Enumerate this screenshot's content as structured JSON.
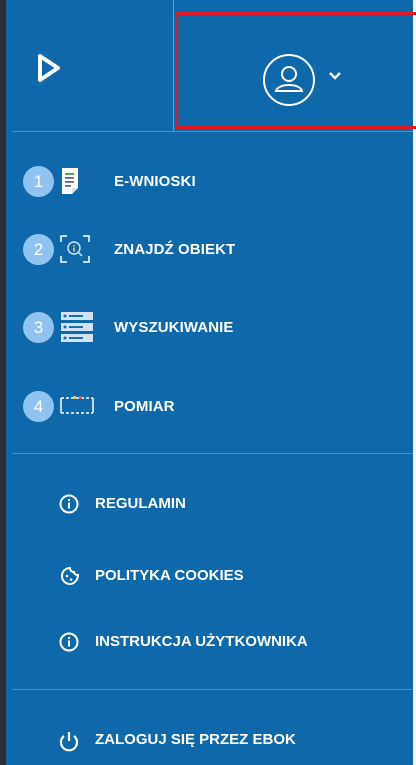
{
  "header": {
    "logo_icon": "play-logo-icon",
    "user_icon": "user-avatar-icon",
    "dropdown_icon": "chevron-down-icon"
  },
  "menu": [
    {
      "number": "1",
      "label": "E-WNIOSKI",
      "icon": "document-icon"
    },
    {
      "number": "2",
      "label": "ZNAJDŹ OBIEKT",
      "icon": "find-object-icon"
    },
    {
      "number": "3",
      "label": "WYSZUKIWANIE",
      "icon": "search-list-icon"
    },
    {
      "number": "4",
      "label": "POMIAR",
      "icon": "measure-icon"
    }
  ],
  "links": [
    {
      "label": "REGULAMIN",
      "icon": "info-icon"
    },
    {
      "label": "POLITYKA COOKIES",
      "icon": "cookie-icon"
    },
    {
      "label": "INSTRUKCJA UŻYTKOWNIKA",
      "icon": "info-icon"
    }
  ],
  "login": {
    "label": "ZALOGUJ SIĘ PRZEZ EBOK",
    "icon": "power-icon"
  },
  "colors": {
    "panel_bg": "#0e68aa",
    "badge": "#8fc4f2",
    "highlight_border": "#e21b23"
  }
}
